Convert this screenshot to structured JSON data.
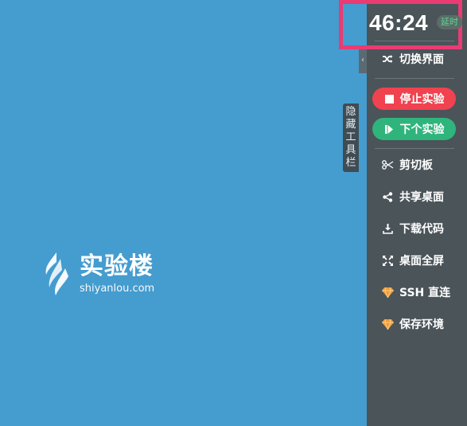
{
  "desktop": {
    "logo_title": "实验楼",
    "logo_subtitle": "shiyanlou.com"
  },
  "toolbar_tab": {
    "label_chars": [
      "隐",
      "藏",
      "工",
      "具",
      "栏"
    ]
  },
  "sidebar": {
    "timer": "46:24",
    "delay_badge": "延时",
    "switch_view": "切换界面",
    "stop_lab": "停止实验",
    "next_lab": "下个实验",
    "clipboard": "剪切板",
    "share_desktop": "共享桌面",
    "download_code": "下载代码",
    "fullscreen": "桌面全屏",
    "ssh_connect": "SSH 直连",
    "save_env": "保存环境"
  },
  "colors": {
    "desktop_bg": "#459ccf",
    "sidebar_bg": "#4a5459",
    "highlight_box": "#ea3b73",
    "stop_button": "#f0424f",
    "next_button": "#2fb47c",
    "badge_text": "#5fd39b",
    "vip_icon": "#f29b38"
  },
  "icons": {
    "switch_view": "shuffle-icon",
    "stop_lab": "stop-icon",
    "next_lab": "step-forward-icon",
    "clipboard": "scissors-icon",
    "share_desktop": "share-icon",
    "download_code": "download-icon",
    "fullscreen": "expand-icon",
    "ssh_connect": "diamond-icon",
    "save_env": "diamond-icon"
  }
}
